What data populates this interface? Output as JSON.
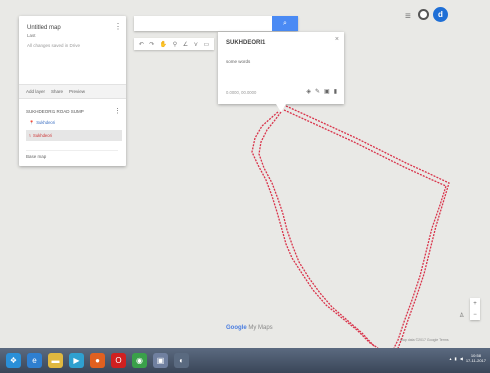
{
  "panel": {
    "title": "Untitled map",
    "subtitle": "Last",
    "meta": "All changes saved in Drive",
    "actions": [
      "Add layer",
      "Share",
      "Preview"
    ],
    "layer_name": "SUKHDEORI1 ROAD SUMP",
    "items": [
      "Sukhdeori",
      "Sukhdeori"
    ],
    "base_map": "Base map"
  },
  "search": {
    "placeholder": "",
    "button_icon": "search-icon"
  },
  "toolbar": {
    "icons": [
      "undo-icon",
      "redo-icon",
      "hand-icon",
      "marker-icon",
      "line-icon",
      "route-icon",
      "ruler-icon"
    ]
  },
  "popup": {
    "title": "SUKHDEORI1",
    "description": "some words",
    "coords": "0.0000, 00.0000",
    "icons": [
      "paint-icon",
      "edit-icon",
      "photo-icon",
      "delete-icon"
    ],
    "close": "×"
  },
  "topright": {
    "menu": "≡",
    "avatar": "d"
  },
  "zoom": {
    "plus": "+",
    "minus": "−"
  },
  "logo": {
    "google": "Google",
    "suffix": "My Maps"
  },
  "credits": "Map data ©2017 Google  Terms",
  "taskbar": {
    "apps": [
      {
        "name": "start-orb",
        "color": "#2a8fd8",
        "glyph": "❖"
      },
      {
        "name": "ie-icon",
        "color": "#2f7fd0",
        "glyph": "e"
      },
      {
        "name": "explorer-icon",
        "color": "#e0b840",
        "glyph": "▬"
      },
      {
        "name": "media-icon",
        "color": "#2fa0d0",
        "glyph": "▶"
      },
      {
        "name": "firefox-icon",
        "color": "#e06020",
        "glyph": "●"
      },
      {
        "name": "opera-icon",
        "color": "#d02020",
        "glyph": "O"
      },
      {
        "name": "chrome-icon",
        "color": "#3aa04a",
        "glyph": "◉"
      },
      {
        "name": "app-icon",
        "color": "#7080a0",
        "glyph": "▣"
      },
      {
        "name": "app2-icon",
        "color": "#5a6a80",
        "glyph": "◐"
      }
    ],
    "time": "10:58",
    "date": "17-11-2017"
  },
  "colors": {
    "route": "#d9334a",
    "accent": "#4a8af4"
  }
}
